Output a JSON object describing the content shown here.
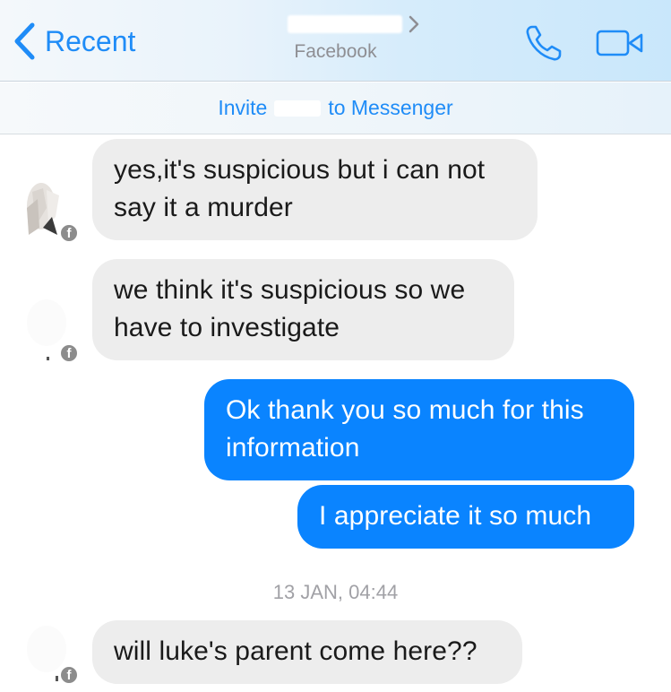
{
  "header": {
    "back_label": "Recent",
    "contact_subtitle": "Facebook",
    "accent_color": "#1f8cf7"
  },
  "invite": {
    "prefix": "Invite",
    "suffix": "to Messenger"
  },
  "messages": [
    {
      "direction": "incoming",
      "text_lines": [
        "yes,it's suspicious but i can not",
        "say it a murder"
      ]
    },
    {
      "direction": "incoming",
      "text_lines": [
        "we think it's suspicious so we",
        "have to investigate"
      ]
    },
    {
      "direction": "outgoing",
      "text_lines": [
        "Ok thank you so much for this",
        "information"
      ]
    },
    {
      "direction": "outgoing",
      "text_lines": [
        "I appreciate it so much"
      ]
    },
    {
      "direction": "incoming",
      "text_lines": [
        "will luke's parent come here??"
      ]
    }
  ],
  "timestamp": "13 JAN, 04:44",
  "icons": {
    "back": "chevron-left-icon",
    "call": "phone-icon",
    "video": "video-camera-icon",
    "badge": "facebook-icon"
  },
  "colors": {
    "outgoing_bubble": "#0a84ff",
    "incoming_bubble": "#ededed"
  }
}
